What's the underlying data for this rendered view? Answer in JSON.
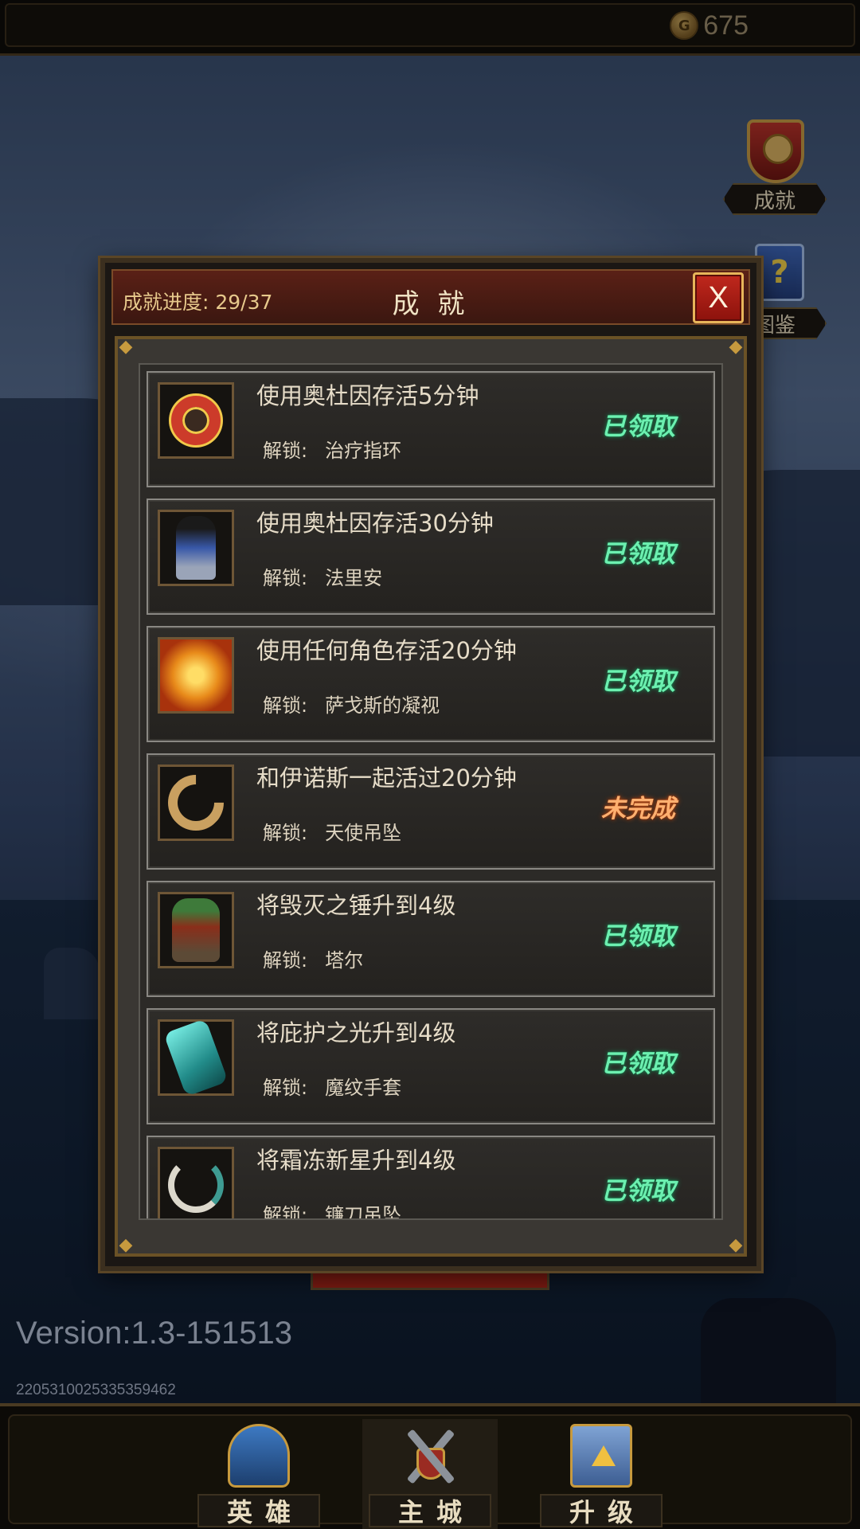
{
  "topbar": {
    "gold": "675",
    "coin_icon": "gold-coin-icon"
  },
  "side_buttons": [
    {
      "label": "成就",
      "icon": "achievement-emblem-icon"
    },
    {
      "label": "图鉴",
      "icon": "codex-book-icon"
    }
  ],
  "dialog": {
    "progress_label": "成就进度: 29/37",
    "title": "成 就",
    "close_label": "X",
    "items": [
      {
        "title": "使用奥杜因存活5分钟",
        "unlock_label": "解锁:",
        "unlock_value": "治疗指环",
        "status": "已领取",
        "icon": "healing-ring-icon"
      },
      {
        "title": "使用奥杜因存活30分钟",
        "unlock_label": "解锁:",
        "unlock_value": "法里安",
        "status": "已领取",
        "icon": "hero-falian-icon"
      },
      {
        "title": "使用任何角色存活20分钟",
        "unlock_label": "解锁:",
        "unlock_value": "萨戈斯的凝视",
        "status": "已领取",
        "icon": "sargos-gaze-icon"
      },
      {
        "title": "和伊诺斯一起活过20分钟",
        "unlock_label": "解锁:",
        "unlock_value": "天使吊坠",
        "status": "未完成",
        "icon": "angel-pendant-icon"
      },
      {
        "title": "将毁灭之锤升到4级",
        "unlock_label": "解锁:",
        "unlock_value": "塔尔",
        "status": "已领取",
        "icon": "hero-tal-icon"
      },
      {
        "title": "将庇护之光升到4级",
        "unlock_label": "解锁:",
        "unlock_value": "魔纹手套",
        "status": "已领取",
        "icon": "rune-gauntlet-icon"
      },
      {
        "title": "将霜冻新星升到4级",
        "unlock_label": "解锁:",
        "unlock_value": "镰刀吊坠",
        "status": "已领取",
        "icon": "scythe-pendant-icon"
      }
    ]
  },
  "footer": {
    "version": "Version:1.3-151513",
    "device_id": "220531002533535​9462"
  },
  "bottom_nav": [
    {
      "label": "英雄",
      "icon": "helmet-icon"
    },
    {
      "label": "主城",
      "icon": "crossed-swords-icon"
    },
    {
      "label": "升级",
      "icon": "castle-upgrade-icon"
    }
  ],
  "colors": {
    "done": "#6cf0b0",
    "todo": "#ffb070",
    "close": "#c0281d"
  }
}
